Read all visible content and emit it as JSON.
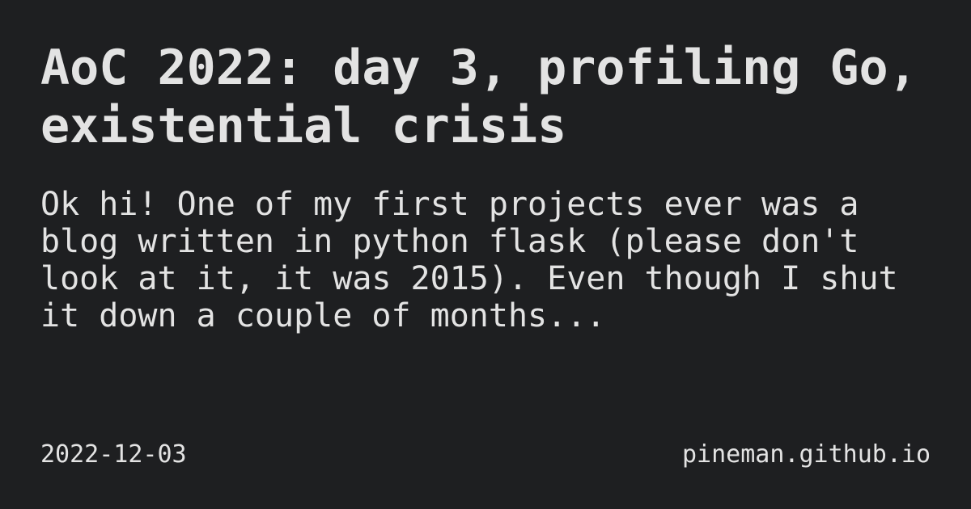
{
  "title": "AoC 2022: day 3, profiling Go, existential crisis",
  "excerpt": "Ok hi! One of my first projects ever was a blog written in python flask (please don't look at it, it was 2015). Even though I shut it down a couple of months...",
  "date": "2022-12-03",
  "site": "pineman.github.io",
  "colors": {
    "background": "#1e1f21",
    "text": "#e3e3e3"
  }
}
